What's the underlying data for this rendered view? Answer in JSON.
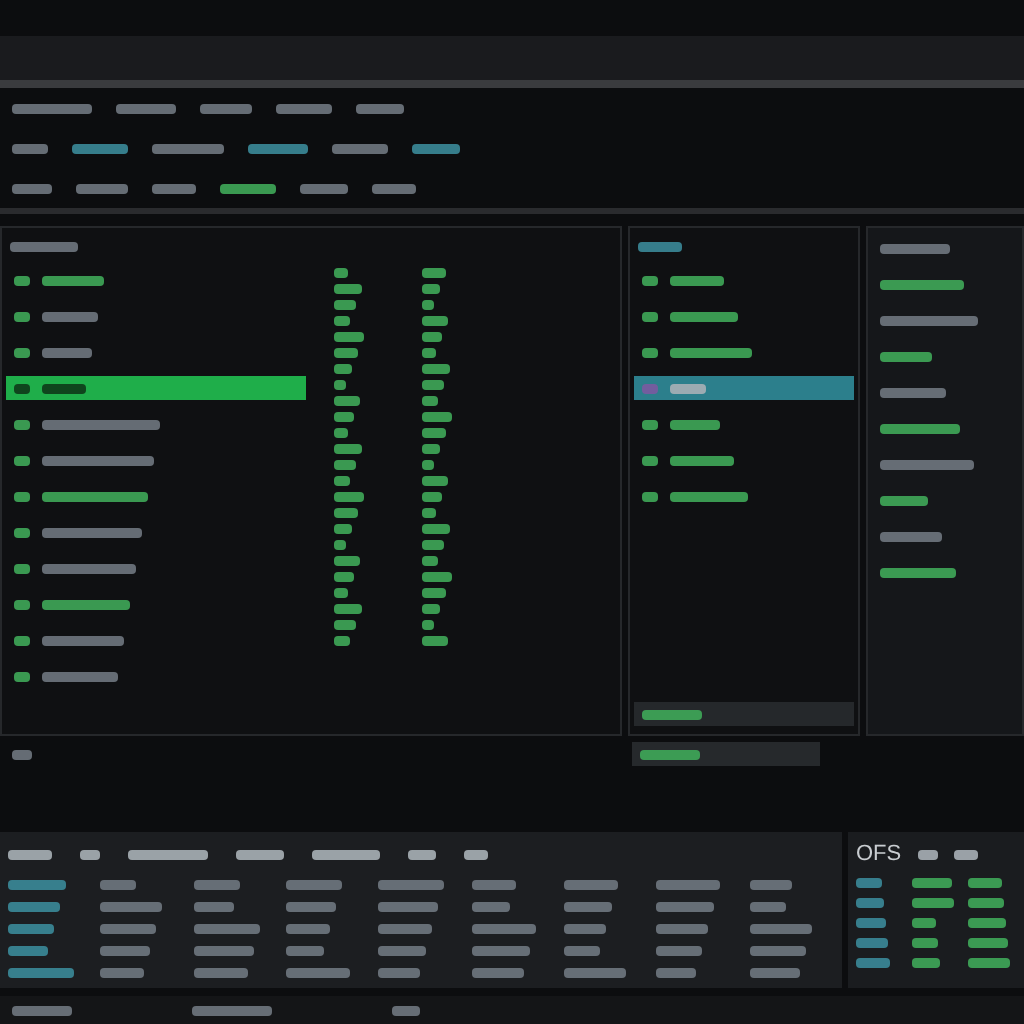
{
  "left_panel": {
    "rows": [
      {
        "selected": false
      },
      {
        "selected": false
      },
      {
        "selected": false
      },
      {
        "selected": true
      },
      {
        "selected": false
      },
      {
        "selected": false
      },
      {
        "selected": false
      },
      {
        "selected": false
      },
      {
        "selected": false
      },
      {
        "selected": false
      },
      {
        "selected": false
      },
      {
        "selected": false
      }
    ]
  },
  "middle_panel": {
    "rows": [
      {
        "selected": false
      },
      {
        "selected": false
      },
      {
        "selected": false
      },
      {
        "selected": true
      },
      {
        "selected": false
      },
      {
        "selected": false
      },
      {
        "selected": false
      }
    ]
  },
  "right_panel": {
    "rows": [
      {
        "selected": false
      },
      {
        "selected": false
      },
      {
        "selected": false
      },
      {
        "selected": false
      },
      {
        "selected": false
      },
      {
        "selected": false
      },
      {
        "selected": false
      },
      {
        "selected": false
      },
      {
        "selected": false
      },
      {
        "selected": false
      }
    ]
  },
  "bottom_panel": {
    "label": "OFS"
  }
}
